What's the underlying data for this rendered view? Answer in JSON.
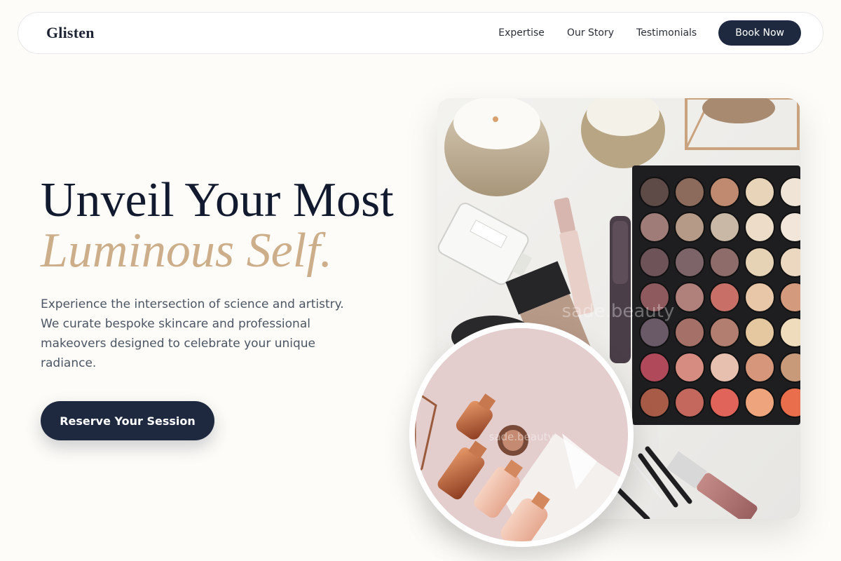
{
  "nav": {
    "brand": "Glisten",
    "links": [
      {
        "label": "Expertise"
      },
      {
        "label": "Our Story"
      },
      {
        "label": "Testimonials"
      }
    ],
    "cta_label": "Book Now"
  },
  "hero": {
    "title_line1": "Unveil Your Most",
    "title_line2": "Luminous Self.",
    "description": "Experience the intersection of science and artistry. We curate bespoke skincare and professional makeovers designed to celebrate your unique radiance.",
    "cta_label": "Reserve Your Session"
  },
  "images": {
    "main_watermark": "sade.beauty",
    "circle_watermark": "sade.beauty"
  },
  "colors": {
    "background": "#fdfcf8",
    "navy": "#1e2940",
    "accent_gold": "#cdae8a"
  },
  "palette_swatches": [
    [
      "#5e4a47",
      "#8c6a5c",
      "#c08a70",
      "#e8d4b8",
      "#f0e4d6"
    ],
    [
      "#a07c78",
      "#b59a88",
      "#c9b8a5",
      "#ecdcc8",
      "#f2e6da"
    ],
    [
      "#6e5458",
      "#7d6468",
      "#8e6c6a",
      "#e6d2b4",
      "#ecd8c0"
    ],
    [
      "#8e5a5e",
      "#b0807a",
      "#c87068",
      "#e8c6a8",
      "#d49a7e"
    ],
    [
      "#6a5a68",
      "#a47068",
      "#b27e70",
      "#e6c8a0",
      "#eedcbc"
    ],
    [
      "#b04a5a",
      "#d68c80",
      "#e8c0b0",
      "#d6967c",
      "#c89a7a"
    ],
    [
      "#a85c48",
      "#c4685e",
      "#e0645a",
      "#eea47c",
      "#e86e4c"
    ]
  ]
}
